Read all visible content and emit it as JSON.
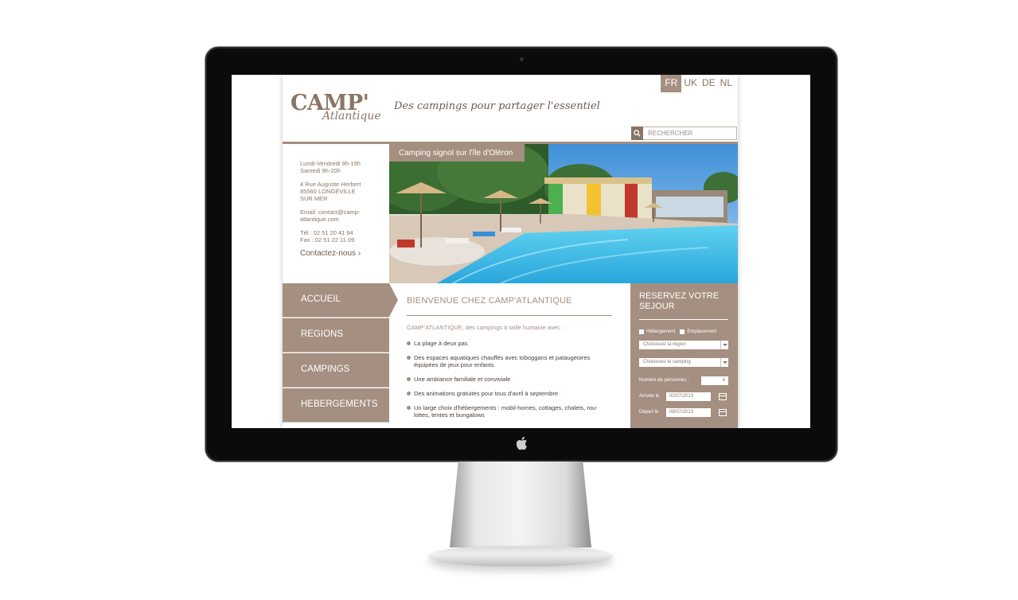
{
  "header": {
    "logo_main": "CAMP'",
    "logo_sub": "Atlantique",
    "tagline": "Des campings pour partager l'essentiel",
    "languages": [
      "FR",
      "UK",
      "DE",
      "NL"
    ],
    "search_placeholder": "RECHERCHER"
  },
  "contact": {
    "hours_1": "Lundi-Vendredi 9h-19h",
    "hours_2": "Samedi 9h-20h",
    "address_1": "4 Rue Auguste Herbert",
    "address_2": "85560 LONGEVILLE",
    "address_3": "SUR MER",
    "email_1": "Email: contact@camp-",
    "email_2": "atlantique.com",
    "tel": "Tél : 02 51 20 41 94",
    "fax": "Fax : 02 51 22 11 09",
    "link": "Contactez-nous"
  },
  "hero": {
    "caption": "Camping signol sur l'île d'Oléron"
  },
  "nav": [
    "ACCUEIL",
    "REGIONS",
    "CAMPINGS",
    "HEBERGEMENTS"
  ],
  "main": {
    "title": "BIENVENUE CHEZ CAMP'ATLANTIQUE",
    "intro": "CAMP'ATLANTIQUE, des campings à taille humaine avec :",
    "bullets": [
      "La plage à deux pas",
      "Des espaces aquatiques chauffés avec toboggans et pataugeoires équipées de jeux pour enfants.",
      "Une ambiance familiale et conviviale",
      "Des animations gratuites pour tous d'avril à septembre",
      "Un large choix d'hébergements : mobil-homes, cottages, chalets, rou-lottes, tentes et bungalows"
    ]
  },
  "booking": {
    "title_1": "RESERVEZ VOTRE",
    "title_2": "SEJOUR",
    "check_1": "Hébergement",
    "check_2": "Emplacement",
    "select_region": "Choisissez la région",
    "select_camping": "Choisissez le camping",
    "persons_label": "Nombre de personnes :",
    "persons_value": "4",
    "arrival_label": "Arrivée le",
    "arrival_value": "02/07/2013",
    "departure_label": "Départ le",
    "departure_value": "09/07/2013"
  },
  "colors": {
    "brand": "#a48f80",
    "brand_dark": "#8a7565",
    "pool": "#4fc3e8"
  }
}
